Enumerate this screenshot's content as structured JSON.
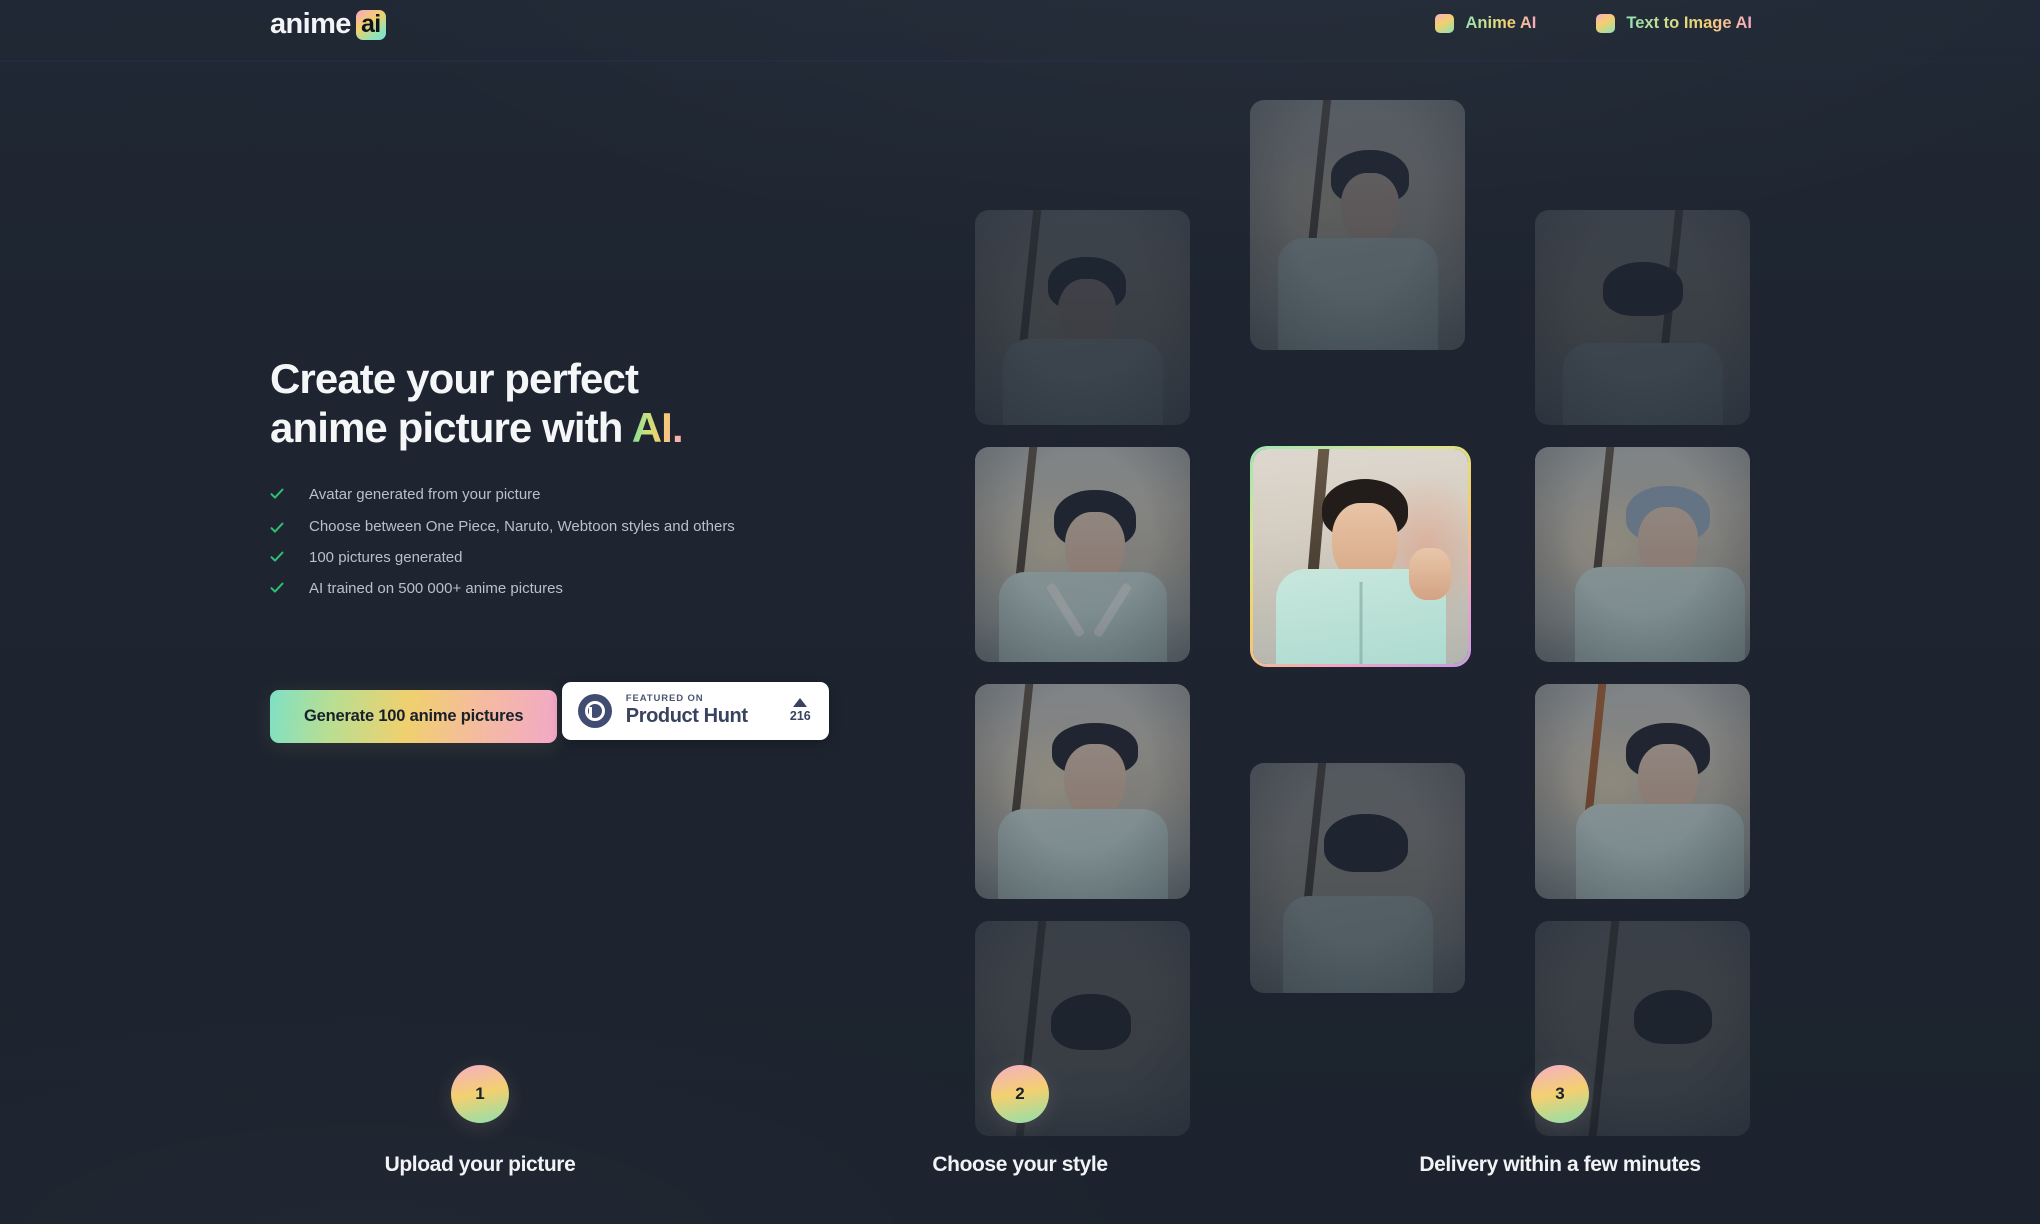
{
  "header": {
    "logo": {
      "text": "anime",
      "badge": "ai"
    },
    "nav": [
      {
        "icon": "gradient-square-icon",
        "label": "Anime AI"
      },
      {
        "icon": "gradient-square-icon",
        "label": "Text to Image AI"
      }
    ]
  },
  "hero": {
    "headline_line1": "Create your perfect",
    "headline_line2": "anime picture with ",
    "headline_accent": "AI.",
    "features": [
      "Avatar generated from your picture",
      "Choose between One Piece, Naruto, Webtoon styles and others",
      "100 pictures generated",
      "AI trained on 500 000+ anime pictures"
    ],
    "cta_label": "Generate 100 anime pictures",
    "product_hunt": {
      "featured_on": "FEATURED ON",
      "name": "Product Hunt",
      "upvotes": "216"
    }
  },
  "gallery": {
    "cards": [
      {
        "id": "a1",
        "type": "anime",
        "state": "faded-top"
      },
      {
        "id": "a2",
        "type": "anime",
        "state": "visible"
      },
      {
        "id": "a3",
        "type": "anime",
        "state": "visible"
      },
      {
        "id": "a4",
        "type": "anime",
        "state": "faded-bottom"
      },
      {
        "id": "b1",
        "type": "anime",
        "state": "faded-top"
      },
      {
        "id": "b2",
        "type": "photo",
        "state": "active"
      },
      {
        "id": "b3",
        "type": "anime",
        "state": "faded-bottom"
      },
      {
        "id": "c1",
        "type": "anime",
        "state": "faded-top"
      },
      {
        "id": "c2",
        "type": "anime",
        "state": "visible"
      },
      {
        "id": "c3",
        "type": "anime",
        "state": "visible"
      },
      {
        "id": "c4",
        "type": "anime",
        "state": "faded-bottom"
      }
    ]
  },
  "steps": [
    {
      "number": "1",
      "title": "Upload your picture",
      "desc": ""
    },
    {
      "number": "2",
      "title": "Choose your style",
      "desc": ""
    },
    {
      "number": "3",
      "title": "Delivery within a few minutes",
      "desc": ""
    }
  ],
  "colors": {
    "background": "#1e2530",
    "gradient_start": "#8fe3b4",
    "gradient_mid": "#f3cf6c",
    "gradient_end": "#f6a9c3",
    "text_primary": "#f2f4f7",
    "text_muted": "#b9c0ca",
    "check_green": "#2fbf71",
    "product_hunt_navy": "#39435f"
  }
}
